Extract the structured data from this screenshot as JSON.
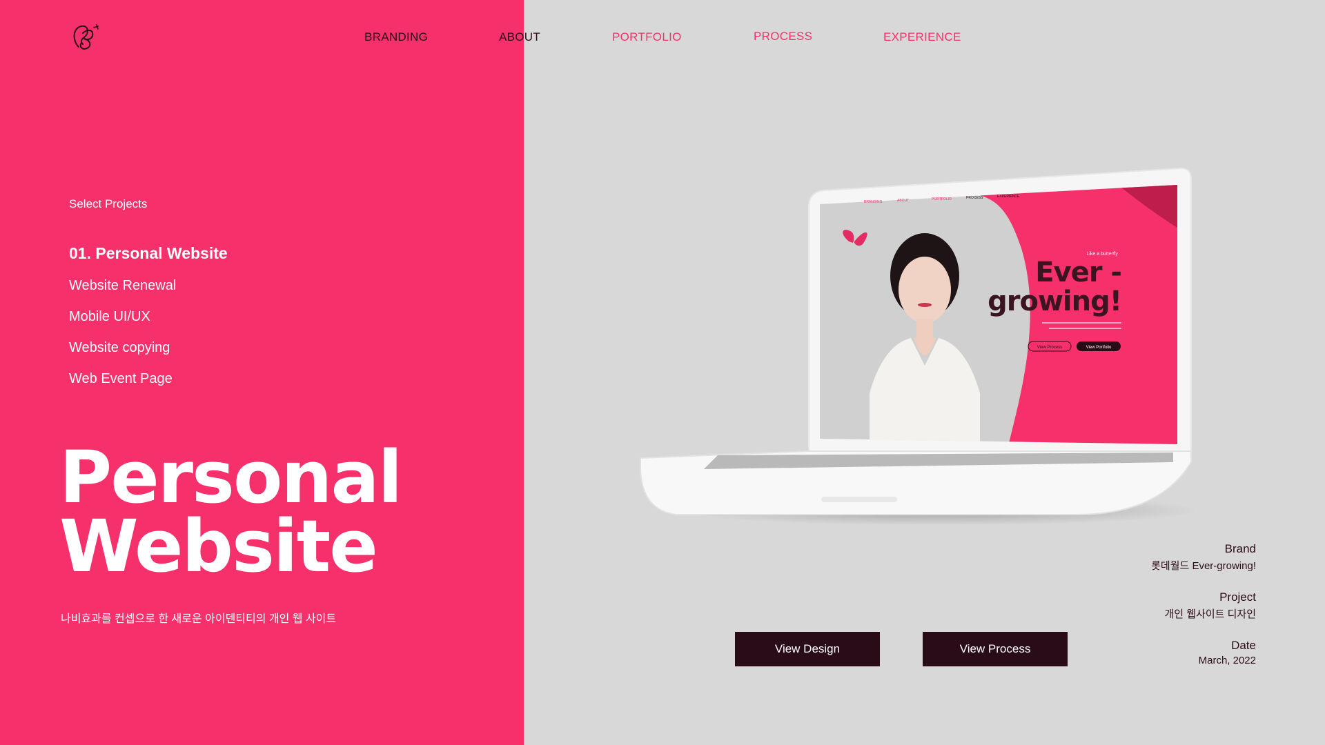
{
  "nav": {
    "items": [
      {
        "label": "BRANDING"
      },
      {
        "label": "ABOUT"
      },
      {
        "label": "PORTFOLIO"
      },
      {
        "label": "PROCESS"
      },
      {
        "label": "EXPERIENCE"
      }
    ]
  },
  "sidebar": {
    "heading": "Select Projects",
    "projects": [
      {
        "label": "01. Personal Website"
      },
      {
        "label": "Website Renewal"
      },
      {
        "label": "Mobile UI/UX"
      },
      {
        "label": "Website copying"
      },
      {
        "label": "Web Event Page"
      }
    ]
  },
  "hero": {
    "title_line1": "Personal",
    "title_line2": "Website",
    "description": "나비효과를 컨셉으로 한 새로운 아이덴티티의 개인 웹 사이트"
  },
  "mockup": {
    "nav": [
      "BRANDING",
      "ABOUT",
      "PORTFOLIO",
      "PROCESS",
      "EXPERIENCE"
    ],
    "tagline": "Like a butterfly",
    "headline_line1": "Ever -",
    "headline_line2": "growing!",
    "btn_process": "View Process",
    "btn_portfolio": "View Portfolio"
  },
  "info": {
    "brand_label": "Brand",
    "brand_value": "롯데월드 Ever-growing!",
    "project_label": "Project",
    "project_value": "개인 웹사이트 디자인",
    "date_label": "Date",
    "date_value": "March, 2022"
  },
  "buttons": {
    "view_design": "View Design",
    "view_process": "View Process"
  },
  "colors": {
    "brand_pink": "#f5306a",
    "dark": "#2a0c18",
    "background_gray": "#d8d8d8"
  }
}
